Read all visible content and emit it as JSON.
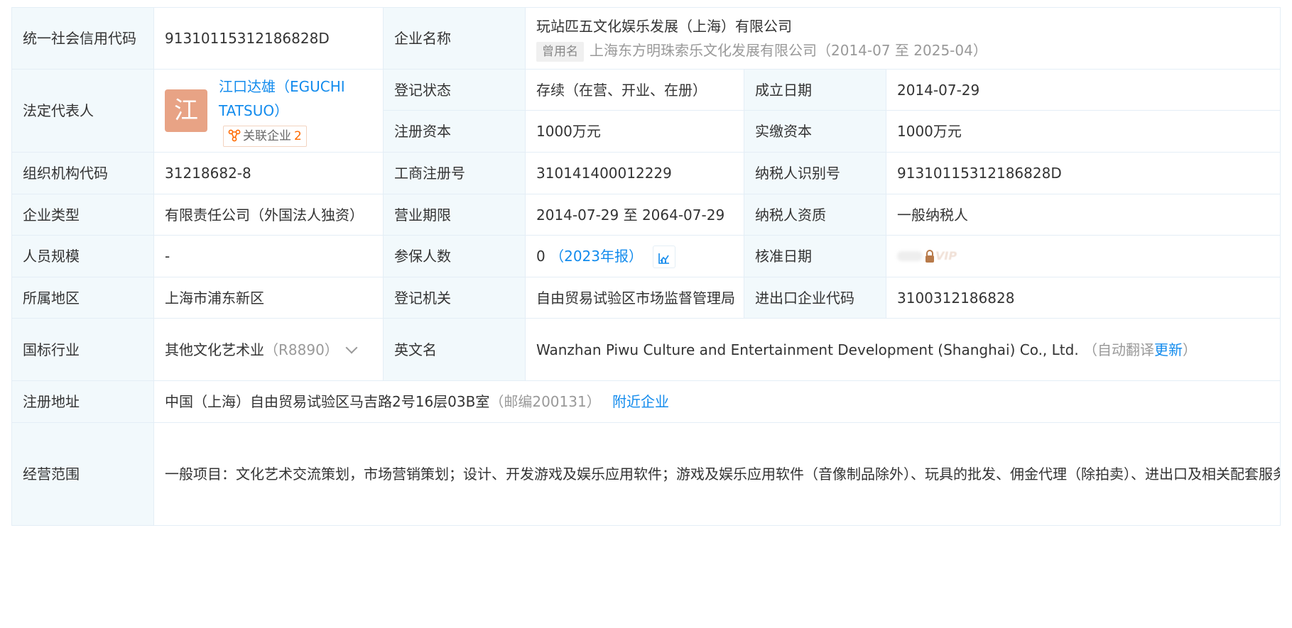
{
  "rows": {
    "credit_code": {
      "label": "统一社会信用代码",
      "value": "91310115312186828D"
    },
    "company_name": {
      "label": "企业名称",
      "value": "玩站匹五文化娱乐发展（上海）有限公司",
      "former_tag": "曾用名",
      "former_value": "上海东方明珠索乐文化发展有限公司（2014-07 至 2025-04）"
    },
    "legal_rep": {
      "label": "法定代表人",
      "avatar_char": "江",
      "name": "江口达雄（EGUCHI TATSUO）",
      "related_label": "关联企业",
      "related_count": "2"
    },
    "reg_status": {
      "label": "登记状态",
      "value": "存续（在营、开业、在册）"
    },
    "established": {
      "label": "成立日期",
      "value": "2014-07-29"
    },
    "reg_capital": {
      "label": "注册资本",
      "value": "1000万元"
    },
    "paid_capital": {
      "label": "实缴资本",
      "value": "1000万元"
    },
    "org_code": {
      "label": "组织机构代码",
      "value": "31218682-8"
    },
    "biz_reg_no": {
      "label": "工商注册号",
      "value": "310141400012229"
    },
    "taxpayer_id": {
      "label": "纳税人识别号",
      "value": "91310115312186828D"
    },
    "company_type": {
      "label": "企业类型",
      "value": "有限责任公司（外国法人独资）"
    },
    "biz_term": {
      "label": "营业期限",
      "value": "2014-07-29 至 2064-07-29"
    },
    "taxpayer_qual": {
      "label": "纳税人资质",
      "value": "一般纳税人"
    },
    "staff_size": {
      "label": "人员规模",
      "value": "-"
    },
    "insured": {
      "label": "参保人数",
      "value": "0",
      "report_link": "（2023年报）"
    },
    "approval_date": {
      "label": "核准日期",
      "vip_text": "VIP"
    },
    "region": {
      "label": "所属地区",
      "value": "上海市浦东新区"
    },
    "reg_authority": {
      "label": "登记机关",
      "value": "自由贸易试验区市场监督管理局"
    },
    "import_export": {
      "label": "进出口企业代码",
      "value": "3100312186828"
    },
    "industry": {
      "label": "国标行业",
      "value": "其他文化艺术业",
      "code": "（R8890）"
    },
    "english_name": {
      "label": "英文名",
      "value": "Wanzhan Piwu Culture and Entertainment Development (Shanghai) Co., Ltd.",
      "auto_note": "（自动翻译",
      "update_link": "更新",
      "close_paren": "）"
    },
    "address": {
      "label": "注册地址",
      "value": "中国（上海）自由贸易试验区马吉路2号16层03B室",
      "postcode": "（邮编200131）",
      "nearby_link": "附近企业"
    },
    "scope": {
      "label": "经营范围",
      "value": "一般项目：文化艺术交流策划，市场营销策划；设计、开发游戏及娱乐应用软件；游戏及娱乐应用软件（音像制品除外）、玩具的批发、佣金代理（除拍卖）、进出口及相关配套服务；从事游戏游艺设备技术专业领域内的技术开发、技术转让、技术咨询、技术服务；商务信息咨询服务（除经纪）；国际贸易，转口贸易；区内企业间的贸易及贸易代理，图书、报纸、期刊、电子出版物的批发，知识产权服务（专利代理除外）。（除依法须经批准的项目外，凭营业执照依法自主开展经营活动）"
    }
  },
  "colors": {
    "label_bg": "#f2f9fc",
    "border": "#e4eef6",
    "link": "#128bed",
    "avatar_bg": "#e8a385",
    "count": "#ff6a00"
  }
}
